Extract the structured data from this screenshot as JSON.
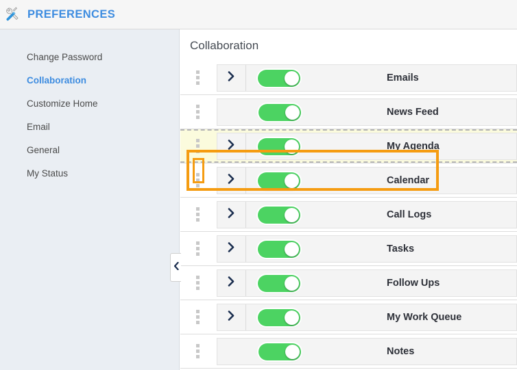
{
  "header": {
    "title": "PREFERENCES",
    "icon": "tools-icon",
    "accent_color": "#3d8ce0",
    "background": "#f6f6f6"
  },
  "sidebar": {
    "background": "#eaeef3",
    "items": [
      {
        "label": "Change Password",
        "active": false
      },
      {
        "label": "Collaboration",
        "active": true
      },
      {
        "label": "Customize Home",
        "active": false
      },
      {
        "label": "Email",
        "active": false
      },
      {
        "label": "General",
        "active": false
      },
      {
        "label": "My Status",
        "active": false
      }
    ],
    "collapse_handle_icon": "chevron-left-icon"
  },
  "content": {
    "section_title": "Collaboration",
    "highlight_color": "#f59c11",
    "toggle_on_color": "#4cd362",
    "rows": [
      {
        "label": "Emails",
        "enabled": true,
        "expandable": true,
        "highlighted": false
      },
      {
        "label": "News Feed",
        "enabled": true,
        "expandable": false,
        "highlighted": false
      },
      {
        "label": "My Agenda",
        "enabled": true,
        "expandable": true,
        "highlighted": true
      },
      {
        "label": "Calendar",
        "enabled": true,
        "expandable": true,
        "highlighted": false
      },
      {
        "label": "Call Logs",
        "enabled": true,
        "expandable": true,
        "highlighted": false
      },
      {
        "label": "Tasks",
        "enabled": true,
        "expandable": true,
        "highlighted": false
      },
      {
        "label": "Follow Ups",
        "enabled": true,
        "expandable": true,
        "highlighted": false
      },
      {
        "label": "My Work Queue",
        "enabled": true,
        "expandable": true,
        "highlighted": false
      },
      {
        "label": "Notes",
        "enabled": true,
        "expandable": false,
        "highlighted": false
      }
    ]
  }
}
